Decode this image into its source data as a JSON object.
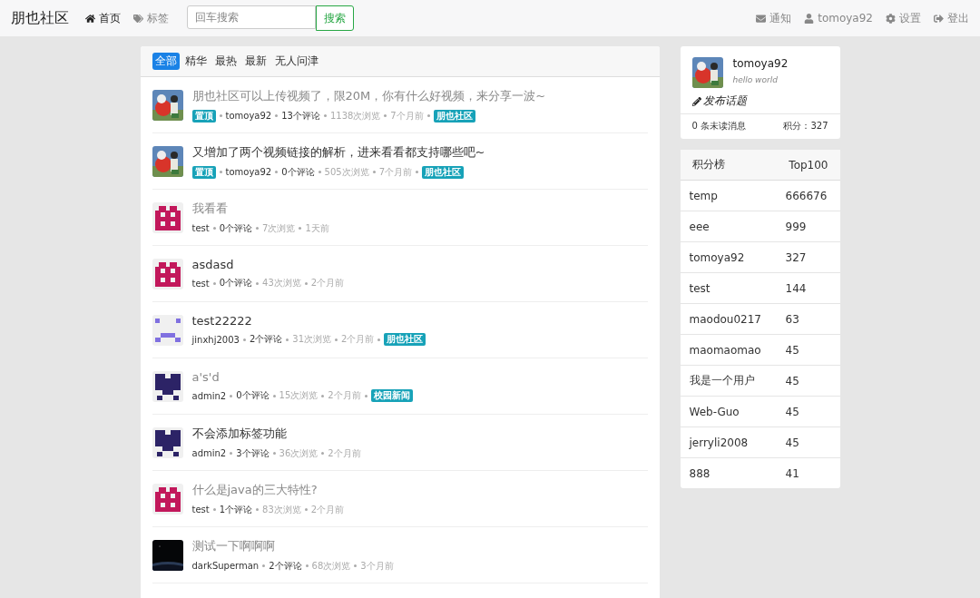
{
  "navbar": {
    "brand": "朋也社区",
    "links": [
      {
        "label": "首页",
        "selected": true
      },
      {
        "label": "标签",
        "selected": false
      }
    ],
    "search": {
      "placeholder": "回车搜索",
      "button": "搜索"
    },
    "user_links": [
      {
        "label": "通知"
      },
      {
        "label": "tomoya92"
      },
      {
        "label": "设置"
      },
      {
        "label": "登出"
      }
    ]
  },
  "tabs": [
    {
      "label": "全部",
      "selected": true
    },
    {
      "label": "精华",
      "selected": false
    },
    {
      "label": "最热",
      "selected": false
    },
    {
      "label": "最新",
      "selected": false
    },
    {
      "label": "无人问津",
      "selected": false
    }
  ],
  "topics": [
    {
      "title": "朋也社区可以上传视频了，限20M，你有什么好视频，来分享一波~",
      "visited": true,
      "top_badge": "置顶",
      "author": "tomoya92",
      "comments": "13个评论",
      "views": "1138次浏览",
      "time": "7个月前",
      "tag": "朋也社区"
    },
    {
      "title": "又增加了两个视频链接的解析，进来看看都支持哪些吧~",
      "visited": false,
      "top_badge": "置顶",
      "author": "tomoya92",
      "comments": "0个评论",
      "views": "505次浏览",
      "time": "7个月前",
      "tag": "朋也社区"
    },
    {
      "avatar": {
        "kind": "castle",
        "color": "#c2185b"
      },
      "title": "我看看",
      "visited": true,
      "author": "test",
      "comments": "0个评论",
      "views": "7次浏览",
      "time": "1天前"
    },
    {
      "avatar": {
        "kind": "castle",
        "color": "#c2185b"
      },
      "title": "asdasd",
      "visited": false,
      "author": "test",
      "comments": "0个评论",
      "views": "43次浏览",
      "time": "2个月前"
    },
    {
      "avatar": {
        "kind": "face",
        "color": "#8070e0"
      },
      "title": "test22222",
      "visited": false,
      "author": "jinxhj2003",
      "comments": "2个评论",
      "views": "31次浏览",
      "time": "2个月前",
      "tag": "朋也社区"
    },
    {
      "avatar": {
        "kind": "robot",
        "color": "#2c2366"
      },
      "title": "a's'd",
      "visited": true,
      "author": "admin2",
      "comments": "0个评论",
      "views": "15次浏览",
      "time": "2个月前",
      "tag": "校园新闻"
    },
    {
      "avatar": {
        "kind": "robot",
        "color": "#2c2366"
      },
      "title": "不会添加标签功能",
      "visited": false,
      "author": "admin2",
      "comments": "3个评论",
      "views": "36次浏览",
      "time": "2个月前"
    },
    {
      "avatar": {
        "kind": "castle",
        "color": "#c2185b"
      },
      "title": "什么是java的三大特性?",
      "visited": true,
      "author": "test",
      "comments": "1个评论",
      "views": "83次浏览",
      "time": "2个月前"
    },
    {
      "avatar": {
        "kind": "space"
      },
      "title": "测试一下啊啊啊",
      "visited": true,
      "author": "darkSuperman",
      "comments": "2个评论",
      "views": "68次浏览",
      "time": "3个月前"
    }
  ],
  "profile": {
    "username": "tomoya92",
    "signature": "hello world",
    "publish": "发布话题",
    "unread": "0 条未读消息",
    "score": "积分：327"
  },
  "ranking": {
    "title": "积分榜",
    "more": "Top100",
    "rows": [
      {
        "name": "temp",
        "score": "666676"
      },
      {
        "name": "eee",
        "score": "999"
      },
      {
        "name": "tomoya92",
        "score": "327"
      },
      {
        "name": "test",
        "score": "144"
      },
      {
        "name": "maodou0217",
        "score": "63"
      },
      {
        "name": "maomaomao",
        "score": "45"
      },
      {
        "name": "我是一个用户",
        "score": "45"
      },
      {
        "name": "Web-Guo",
        "score": "45"
      },
      {
        "name": "jerryli2008",
        "score": "45"
      },
      {
        "name": "888",
        "score": "41"
      }
    ]
  }
}
